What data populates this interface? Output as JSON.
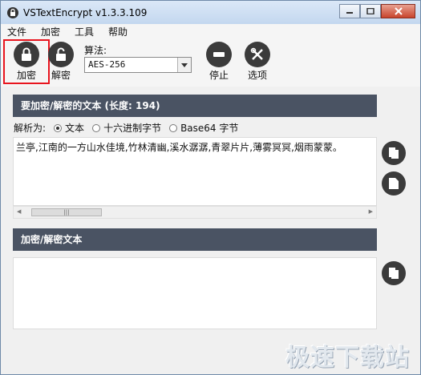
{
  "window": {
    "title": "VSTextEncrypt v1.3.3.109"
  },
  "menu": [
    "文件",
    "加密",
    "工具",
    "帮助"
  ],
  "toolbar": {
    "encrypt_label": "加密",
    "decrypt_label": "解密",
    "algorithm_label": "算法:",
    "algorithm_value": "AES-256",
    "stop_label": "停止",
    "options_label": "选项"
  },
  "input_section": {
    "header": "要加密/解密的文本 (长度: 194)",
    "parse_label": "解析为:",
    "options": [
      "文本",
      "十六进制字节",
      "Base64 字节"
    ],
    "selected": "文本",
    "text": "兰亭,江南的一方山水佳境,竹林清幽,溪水潺潺,青翠片片,薄雾冥冥,烟雨蒙蒙。"
  },
  "output_section": {
    "header": "加密/解密文本",
    "text": ""
  },
  "watermark": "极速下载站",
  "colors": {
    "header_bg": "#4a5363",
    "highlight": "#e8141e",
    "icon": "#3b3b3b"
  }
}
